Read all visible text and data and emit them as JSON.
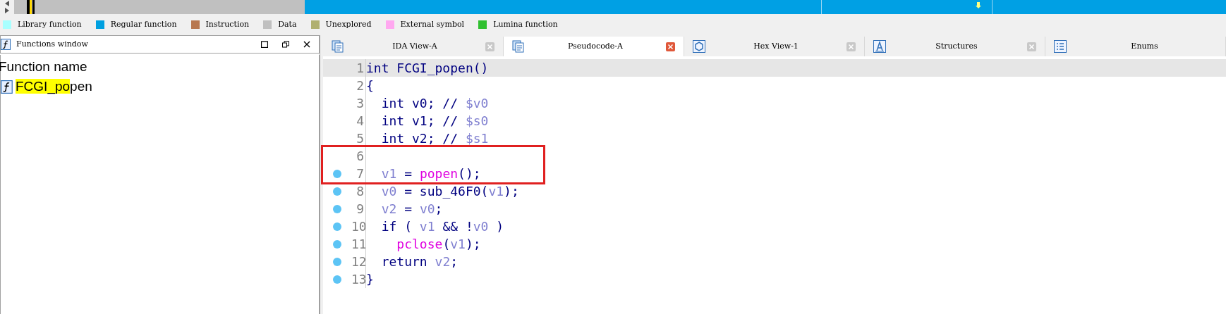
{
  "legend": [
    {
      "label": "Library function",
      "color": "#a8ffff"
    },
    {
      "label": "Regular function",
      "color": "#00a0e0"
    },
    {
      "label": "Instruction",
      "color": "#b87850"
    },
    {
      "label": "Data",
      "color": "#c0c0c0"
    },
    {
      "label": "Unexplored",
      "color": "#b0b070"
    },
    {
      "label": "External symbol",
      "color": "#ffa8f0"
    },
    {
      "label": "Lumina function",
      "color": "#30c030"
    }
  ],
  "functions_window": {
    "title": "Functions window",
    "column": "Function name",
    "items": [
      {
        "match": "FCGI_po",
        "rest": "pen",
        "kind": "function"
      }
    ]
  },
  "tabs": [
    {
      "label": "IDA View-A",
      "kind": "disasm",
      "selected": false,
      "closable": true
    },
    {
      "label": "Pseudocode-A",
      "kind": "pseudo",
      "selected": true,
      "closable": true
    },
    {
      "label": "Hex View-1",
      "kind": "hex",
      "selected": false,
      "closable": true
    },
    {
      "label": "Structures",
      "kind": "struct",
      "selected": false,
      "closable": true
    },
    {
      "label": "Enums",
      "kind": "enum",
      "selected": false,
      "closable": false
    }
  ],
  "code": [
    {
      "number": "1",
      "breakpoint": false,
      "current": true,
      "boxed": false,
      "tokens": [
        {
          "text": "int FCGI_popen()",
          "kind": "plain"
        }
      ]
    },
    {
      "number": "2",
      "breakpoint": false,
      "current": false,
      "boxed": false,
      "tokens": [
        {
          "text": "{",
          "kind": "plain"
        }
      ]
    },
    {
      "number": "3",
      "breakpoint": false,
      "current": false,
      "boxed": false,
      "tokens": [
        {
          "text": "  int v0; // ",
          "kind": "plain"
        },
        {
          "text": "$v0",
          "kind": "var"
        }
      ]
    },
    {
      "number": "4",
      "breakpoint": false,
      "current": false,
      "boxed": false,
      "tokens": [
        {
          "text": "  int v1; // ",
          "kind": "plain"
        },
        {
          "text": "$s0",
          "kind": "var"
        }
      ]
    },
    {
      "number": "5",
      "breakpoint": false,
      "current": false,
      "boxed": false,
      "tokens": [
        {
          "text": "  int v2; // ",
          "kind": "plain"
        },
        {
          "text": "$s1",
          "kind": "var"
        }
      ]
    },
    {
      "number": "6",
      "breakpoint": false,
      "current": false,
      "boxed": true
    },
    {
      "number": "7",
      "breakpoint": true,
      "current": false,
      "boxed": true,
      "tokens": [
        {
          "text": "  v1",
          "kind": "var"
        },
        {
          "text": " = ",
          "kind": "plain"
        },
        {
          "text": "popen",
          "kind": "import"
        },
        {
          "text": "();",
          "kind": "plain"
        }
      ]
    },
    {
      "number": "8",
      "breakpoint": true,
      "current": false,
      "boxed": false,
      "tokens": [
        {
          "text": "  v0",
          "kind": "var"
        },
        {
          "text": " = sub_46F0(",
          "kind": "plain"
        },
        {
          "text": "v1",
          "kind": "var"
        },
        {
          "text": ");",
          "kind": "plain"
        }
      ]
    },
    {
      "number": "9",
      "breakpoint": true,
      "current": false,
      "boxed": false,
      "tokens": [
        {
          "text": "  v2",
          "kind": "var"
        },
        {
          "text": " = ",
          "kind": "plain"
        },
        {
          "text": "v0",
          "kind": "var"
        },
        {
          "text": ";",
          "kind": "plain"
        }
      ]
    },
    {
      "number": "10",
      "breakpoint": true,
      "current": false,
      "boxed": false,
      "tokens": [
        {
          "text": "  if ( ",
          "kind": "plain"
        },
        {
          "text": "v1",
          "kind": "var"
        },
        {
          "text": " && !",
          "kind": "plain"
        },
        {
          "text": "v0",
          "kind": "var"
        },
        {
          "text": " )",
          "kind": "plain"
        }
      ]
    },
    {
      "number": "11",
      "breakpoint": true,
      "current": false,
      "boxed": false,
      "tokens": [
        {
          "text": "    pclose",
          "kind": "import"
        },
        {
          "text": "(",
          "kind": "plain"
        },
        {
          "text": "v1",
          "kind": "var"
        },
        {
          "text": ");",
          "kind": "plain"
        }
      ]
    },
    {
      "number": "12",
      "breakpoint": true,
      "current": false,
      "boxed": false,
      "tokens": [
        {
          "text": "  return ",
          "kind": "plain"
        },
        {
          "text": "v2",
          "kind": "var"
        },
        {
          "text": ";",
          "kind": "plain"
        }
      ]
    },
    {
      "number": "13",
      "breakpoint": true,
      "current": false,
      "boxed": false,
      "tokens": [
        {
          "text": "}",
          "kind": "plain"
        }
      ]
    }
  ]
}
